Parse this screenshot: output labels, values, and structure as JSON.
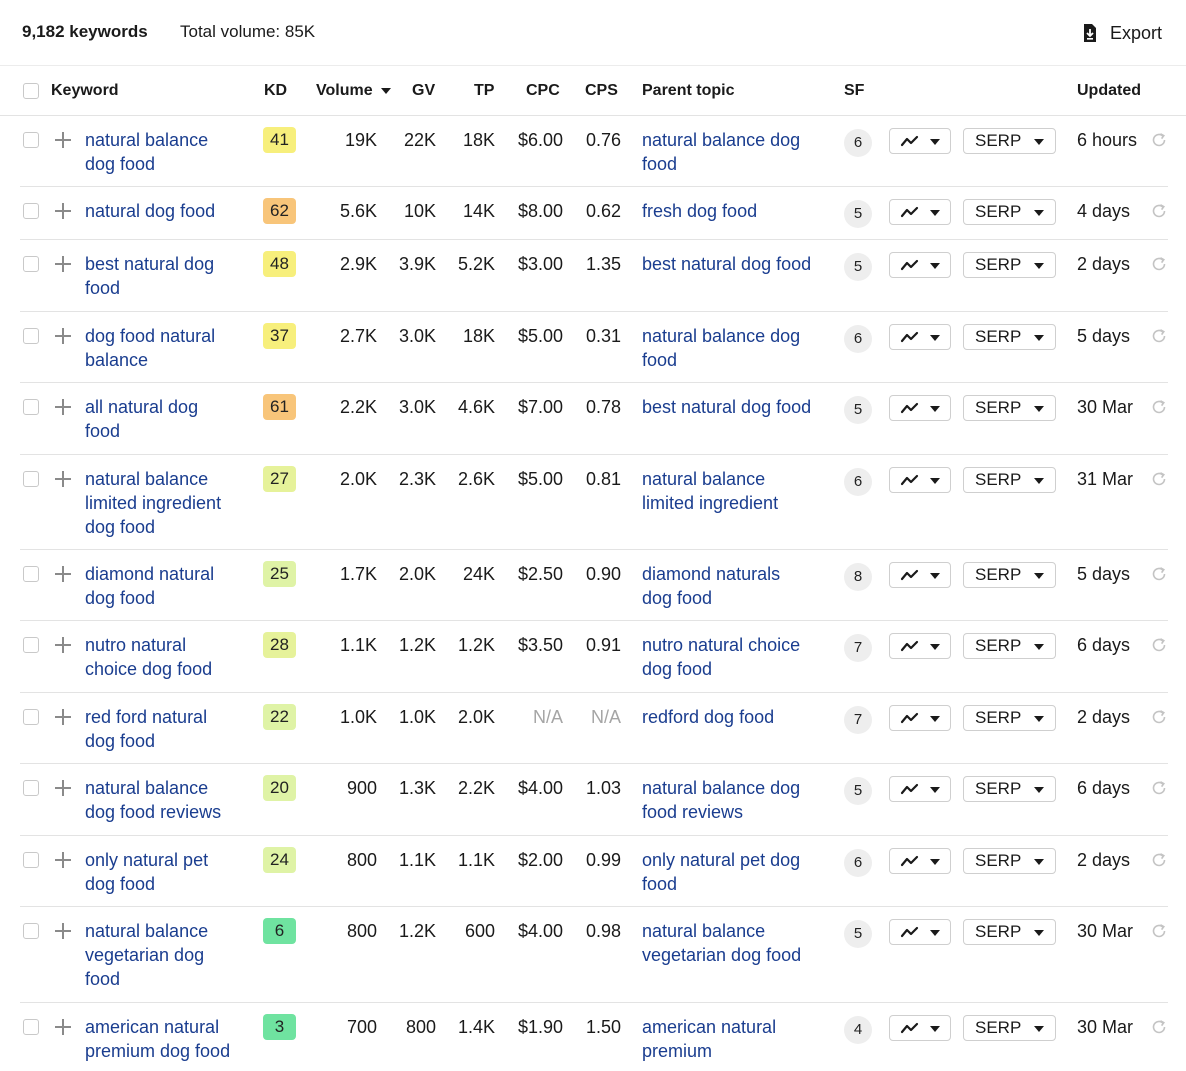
{
  "toolbar": {
    "keyword_count": "9,182 keywords",
    "total_volume": "Total volume: 85K",
    "export_label": "Export"
  },
  "columns": {
    "keyword": "Keyword",
    "kd": "KD",
    "volume": "Volume",
    "gv": "GV",
    "tp": "TP",
    "cpc": "CPC",
    "cps": "CPS",
    "parent_topic": "Parent topic",
    "sf": "SF",
    "updated": "Updated"
  },
  "kd_colors": {
    "light_green": "#dff3a6",
    "yellow_green": "#e6f29a",
    "yellow": "#f7ef7c",
    "orange": "#f8c57a",
    "green": "#6fe3a0"
  },
  "rows": [
    {
      "keyword": [
        "natural balance",
        "dog food"
      ],
      "kd": "41",
      "kd_color": "#f7ef7c",
      "volume": "19K",
      "gv": "22K",
      "tp": "18K",
      "cpc": "$6.00",
      "cps": "0.76",
      "parent": [
        "natural balance dog",
        "food"
      ],
      "sf": "6",
      "serp": "SERP",
      "updated": "6 hours"
    },
    {
      "keyword": [
        "natural dog food"
      ],
      "kd": "62",
      "kd_color": "#f8c57a",
      "volume": "5.6K",
      "gv": "10K",
      "tp": "14K",
      "cpc": "$8.00",
      "cps": "0.62",
      "parent": [
        "fresh dog food"
      ],
      "sf": "5",
      "serp": "SERP",
      "updated": "4 days"
    },
    {
      "keyword": [
        "best natural dog",
        "food"
      ],
      "kd": "48",
      "kd_color": "#f7ef7c",
      "volume": "2.9K",
      "gv": "3.9K",
      "tp": "5.2K",
      "cpc": "$3.00",
      "cps": "1.35",
      "parent": [
        "best natural dog food"
      ],
      "sf": "5",
      "serp": "SERP",
      "updated": "2 days"
    },
    {
      "keyword": [
        "dog food natural",
        "balance"
      ],
      "kd": "37",
      "kd_color": "#f7ef7c",
      "volume": "2.7K",
      "gv": "3.0K",
      "tp": "18K",
      "cpc": "$5.00",
      "cps": "0.31",
      "parent": [
        "natural balance dog",
        "food"
      ],
      "sf": "6",
      "serp": "SERP",
      "updated": "5 days"
    },
    {
      "keyword": [
        "all natural dog",
        "food"
      ],
      "kd": "61",
      "kd_color": "#f8c57a",
      "volume": "2.2K",
      "gv": "3.0K",
      "tp": "4.6K",
      "cpc": "$7.00",
      "cps": "0.78",
      "parent": [
        "best natural dog food"
      ],
      "sf": "5",
      "serp": "SERP",
      "updated": "30 Mar"
    },
    {
      "keyword": [
        "natural balance",
        "limited ingredient",
        "dog food"
      ],
      "kd": "27",
      "kd_color": "#e6f29a",
      "volume": "2.0K",
      "gv": "2.3K",
      "tp": "2.6K",
      "cpc": "$5.00",
      "cps": "0.81",
      "parent": [
        "natural balance",
        "limited ingredient"
      ],
      "sf": "6",
      "serp": "SERP",
      "updated": "31 Mar"
    },
    {
      "keyword": [
        "diamond natural",
        "dog food"
      ],
      "kd": "25",
      "kd_color": "#dff3a6",
      "volume": "1.7K",
      "gv": "2.0K",
      "tp": "24K",
      "cpc": "$2.50",
      "cps": "0.90",
      "parent": [
        "diamond naturals",
        "dog food"
      ],
      "sf": "8",
      "serp": "SERP",
      "updated": "5 days"
    },
    {
      "keyword": [
        "nutro natural",
        "choice dog food"
      ],
      "kd": "28",
      "kd_color": "#e6f29a",
      "volume": "1.1K",
      "gv": "1.2K",
      "tp": "1.2K",
      "cpc": "$3.50",
      "cps": "0.91",
      "parent": [
        "nutro natural choice",
        "dog food"
      ],
      "sf": "7",
      "serp": "SERP",
      "updated": "6 days"
    },
    {
      "keyword": [
        "red ford natural",
        "dog food"
      ],
      "kd": "22",
      "kd_color": "#dff3a6",
      "volume": "1.0K",
      "gv": "1.0K",
      "tp": "2.0K",
      "cpc": "N/A",
      "cps": "N/A",
      "parent": [
        "redford dog food"
      ],
      "sf": "7",
      "serp": "SERP",
      "updated": "2 days"
    },
    {
      "keyword": [
        "natural balance",
        "dog food reviews"
      ],
      "kd": "20",
      "kd_color": "#dff3a6",
      "volume": "900",
      "gv": "1.3K",
      "tp": "2.2K",
      "cpc": "$4.00",
      "cps": "1.03",
      "parent": [
        "natural balance dog",
        "food reviews"
      ],
      "sf": "5",
      "serp": "SERP",
      "updated": "6 days"
    },
    {
      "keyword": [
        "only natural pet",
        "dog food"
      ],
      "kd": "24",
      "kd_color": "#dff3a6",
      "volume": "800",
      "gv": "1.1K",
      "tp": "1.1K",
      "cpc": "$2.00",
      "cps": "0.99",
      "parent": [
        "only natural pet dog",
        "food"
      ],
      "sf": "6",
      "serp": "SERP",
      "updated": "2 days"
    },
    {
      "keyword": [
        "natural balance",
        "vegetarian dog",
        "food"
      ],
      "kd": "6",
      "kd_color": "#6fe3a0",
      "volume": "800",
      "gv": "1.2K",
      "tp": "600",
      "cpc": "$4.00",
      "cps": "0.98",
      "parent": [
        "natural balance",
        "vegetarian dog food"
      ],
      "sf": "5",
      "serp": "SERP",
      "updated": "30 Mar"
    },
    {
      "keyword": [
        "american natural",
        "premium dog food"
      ],
      "kd": "3",
      "kd_color": "#6fe3a0",
      "volume": "700",
      "gv": "800",
      "tp": "1.4K",
      "cpc": "$1.90",
      "cps": "1.50",
      "parent": [
        "american natural",
        "premium"
      ],
      "sf": "4",
      "serp": "SERP",
      "updated": "30 Mar"
    }
  ]
}
